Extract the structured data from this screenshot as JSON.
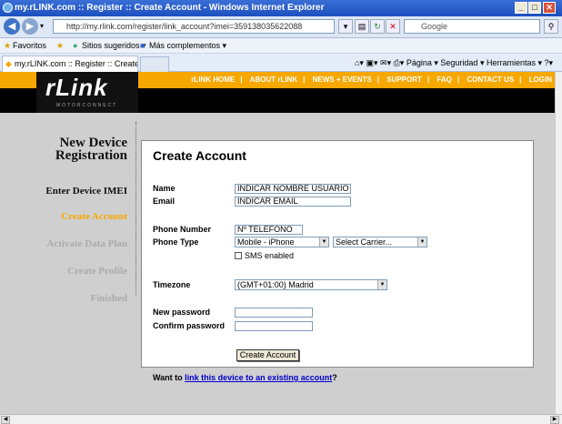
{
  "window": {
    "title": "my.rLINK.com :: Register :: Create Account - Windows Internet Explorer"
  },
  "nav": {
    "address": "http://my.rlink.com/register/link_account?imei=359138035622088",
    "search_placeholder": "Google"
  },
  "favorites": {
    "favorites_label": "Favoritos",
    "suggested_label": "Sitios sugeridos ▾",
    "addons_label": "Más complementos ▾"
  },
  "tabs": {
    "active_tab": "my.rLINK.com :: Register :: Create Account"
  },
  "commands": {
    "page": "Página ▾",
    "security": "Seguridad ▾",
    "tools": "Herramientas ▾"
  },
  "site": {
    "logo": "rLink",
    "logo_sub": "MOTORCONNECT",
    "top_nav": [
      "rLINK HOME",
      "ABOUT rLINK",
      "NEWS + EVENTS",
      "SUPPORT",
      "FAQ",
      "CONTACT US",
      "LOGIN"
    ]
  },
  "sidebar": {
    "title_line1": "New Device",
    "title_line2": "Registration",
    "steps": [
      {
        "label": "Enter Device IMEI",
        "color": "#111111"
      },
      {
        "label": "Create Account",
        "color": "#f6a800"
      },
      {
        "label": "Activate Data Plan",
        "color": "#aaaaaa"
      },
      {
        "label": "Create Profile",
        "color": "#aaaaaa"
      },
      {
        "label": "Finished",
        "color": "#aaaaaa"
      }
    ]
  },
  "form": {
    "heading": "Create Account",
    "name_label": "Name",
    "name_value": "INDICAR NOMBRE USUARIO",
    "email_label": "Email",
    "email_value": "INDICAR EMAIL",
    "phone_number_label": "Phone Number",
    "phone_number_value": "Nº TELEFONO",
    "phone_type_label": "Phone Type",
    "phone_type_value": "Mobile - iPhone",
    "carrier_value": "Select Carrier...",
    "sms_label": "SMS enabled",
    "timezone_label": "Timezone",
    "timezone_value": "(GMT+01:00) Madrid",
    "new_password_label": "New password",
    "confirm_password_label": "Confirm password",
    "submit_label": "Create Account",
    "footer_prefix": "Want to ",
    "footer_link": "link this device to an existing account",
    "footer_suffix": "?"
  },
  "colors": {
    "accent": "#f6a800",
    "link": "#0000cc"
  }
}
